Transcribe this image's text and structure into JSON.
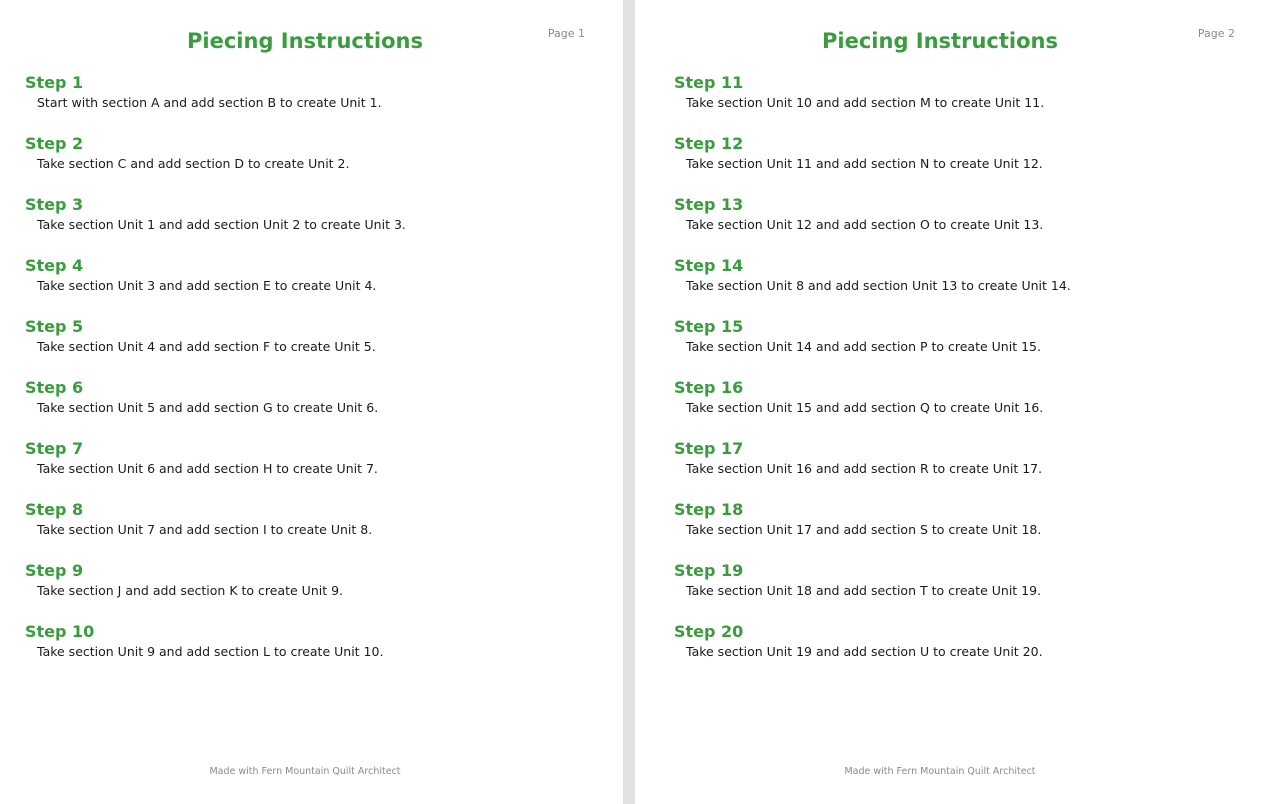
{
  "pages": [
    {
      "title": "Piecing Instructions",
      "page_number": "Page 1",
      "footer": "Made with Fern Mountain Quilt Architect",
      "steps": [
        {
          "title": "Step 1",
          "text": "Start with section A and add section B to create Unit 1."
        },
        {
          "title": "Step 2",
          "text": "Take section C and add section D to create Unit 2."
        },
        {
          "title": "Step 3",
          "text": "Take section Unit 1 and add section Unit 2 to create Unit 3."
        },
        {
          "title": "Step 4",
          "text": "Take section Unit 3 and add section E to create Unit 4."
        },
        {
          "title": "Step 5",
          "text": "Take section Unit 4 and add section F to create Unit 5."
        },
        {
          "title": "Step 6",
          "text": "Take section Unit 5 and add section G to create Unit 6."
        },
        {
          "title": "Step 7",
          "text": "Take section Unit 6 and add section H to create Unit 7."
        },
        {
          "title": "Step 8",
          "text": "Take section Unit 7 and add section I to create Unit 8."
        },
        {
          "title": "Step 9",
          "text": "Take section J and add section K to create Unit 9."
        },
        {
          "title": "Step 10",
          "text": "Take section Unit 9 and add section L to create Unit 10."
        }
      ]
    },
    {
      "title": "Piecing Instructions",
      "page_number": "Page 2",
      "footer": "Made with Fern Mountain Quilt Architect",
      "steps": [
        {
          "title": "Step 11",
          "text": "Take section Unit 10 and add section M to create Unit 11."
        },
        {
          "title": "Step 12",
          "text": "Take section Unit 11 and add section N to create Unit 12."
        },
        {
          "title": "Step 13",
          "text": "Take section Unit 12 and add section O to create Unit 13."
        },
        {
          "title": "Step 14",
          "text": "Take section Unit 8 and add section Unit 13 to create Unit 14."
        },
        {
          "title": "Step 15",
          "text": "Take section Unit 14 and add section P to create Unit 15."
        },
        {
          "title": "Step 16",
          "text": "Take section Unit 15 and add section Q to create Unit 16."
        },
        {
          "title": "Step 17",
          "text": "Take section Unit 16 and add section R to create Unit 17."
        },
        {
          "title": "Step 18",
          "text": "Take section Unit 17 and add section S to create Unit 18."
        },
        {
          "title": "Step 19",
          "text": "Take section Unit 18 and add section T to create Unit 19."
        },
        {
          "title": "Step 20",
          "text": "Take section Unit 19 and add section U to create Unit 20."
        }
      ]
    }
  ]
}
